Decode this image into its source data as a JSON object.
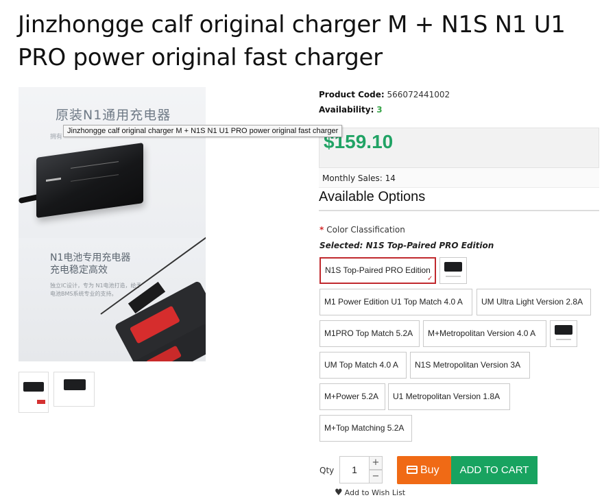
{
  "product": {
    "title": "Jinzhongge calf original charger M + N1S N1 U1 PRO power original fast charger",
    "tooltip": "Jinzhongge calf original charger M + N1S N1 U1 PRO power original fast charger",
    "image_text": {
      "top_heading": "原装N1通用充电器",
      "top_sub": "拥有",
      "bottom_heading_1": "N1电池专用充电器",
      "bottom_heading_2": "充电稳定高效",
      "bottom_body": "独立IC设计，专为 N1电池打造，给予电池BMS系统专业的支持。"
    }
  },
  "details": {
    "code_label": "Product Code:",
    "code_value": "566072441002",
    "availability_label": "Availability:",
    "availability_value": "3",
    "price": "$159.10",
    "monthly_sales": "Monthly Sales: 14"
  },
  "options": {
    "section_title": "Available Options",
    "required_star": "*",
    "label": "Color Classification",
    "selected_text": "Selected: N1S Top-Paired PRO Edition",
    "items": [
      {
        "label": "N1S Top-Paired PRO Edition"
      },
      {
        "label": "M1 Power Edition U1 Top Match 4.0 A"
      },
      {
        "label": "UM Ultra Light Version 2.8A"
      },
      {
        "label": "M1PRO Top Match 5.2A"
      },
      {
        "label": "M+Metropolitan Version 4.0 A"
      },
      {
        "label": "UM Top Match 4.0 A"
      },
      {
        "label": "N1S Metropolitan Version 3A"
      },
      {
        "label": "M+Power 5.2A"
      },
      {
        "label": "U1 Metropolitan Version 1.8A"
      },
      {
        "label": "M+Top Matching 5.2A"
      }
    ],
    "check_mark": "✓"
  },
  "purchase": {
    "qty_label": "Qty",
    "qty_value": "1",
    "plus": "+",
    "minus": "−",
    "buy_label": "Buy",
    "cart_label": "ADD TO CART",
    "wishlist_label": "Add to Wish List",
    "heart": "♥"
  },
  "colors": {
    "price_green": "#21a365",
    "buy_orange": "#f06a15",
    "cart_green": "#18a360",
    "selected_border": "#c0282d"
  }
}
